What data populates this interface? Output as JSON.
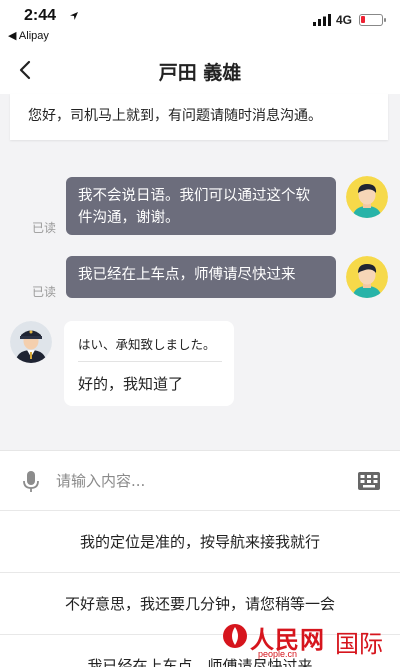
{
  "status_bar": {
    "time": "2:44",
    "back_app": "◀ Alipay",
    "network": "4G"
  },
  "nav": {
    "title": "戸田 義雄"
  },
  "notice": {
    "text": "您好，司机马上就到，有问题请随时消息沟通。"
  },
  "messages": [
    {
      "direction": "outgoing",
      "text": "我不会说日语。我们可以通过这个软件沟通，谢谢。",
      "status": "已读"
    },
    {
      "direction": "outgoing",
      "text": "我已经在上车点，师傅请尽快过来",
      "status": "已读"
    },
    {
      "direction": "incoming",
      "original": "はい、承知致しました。",
      "translation": "好的，我知道了"
    }
  ],
  "input": {
    "placeholder": "请输入内容..."
  },
  "quick_replies": [
    "我的定位是准的，按导航来接我就行",
    "不好意思，我还要几分钟，请您稍等一会",
    "我已经在上车点，师傅请尽快过来"
  ],
  "watermark": {
    "brand": "人民网",
    "url": "people.cn",
    "section": "国际"
  }
}
